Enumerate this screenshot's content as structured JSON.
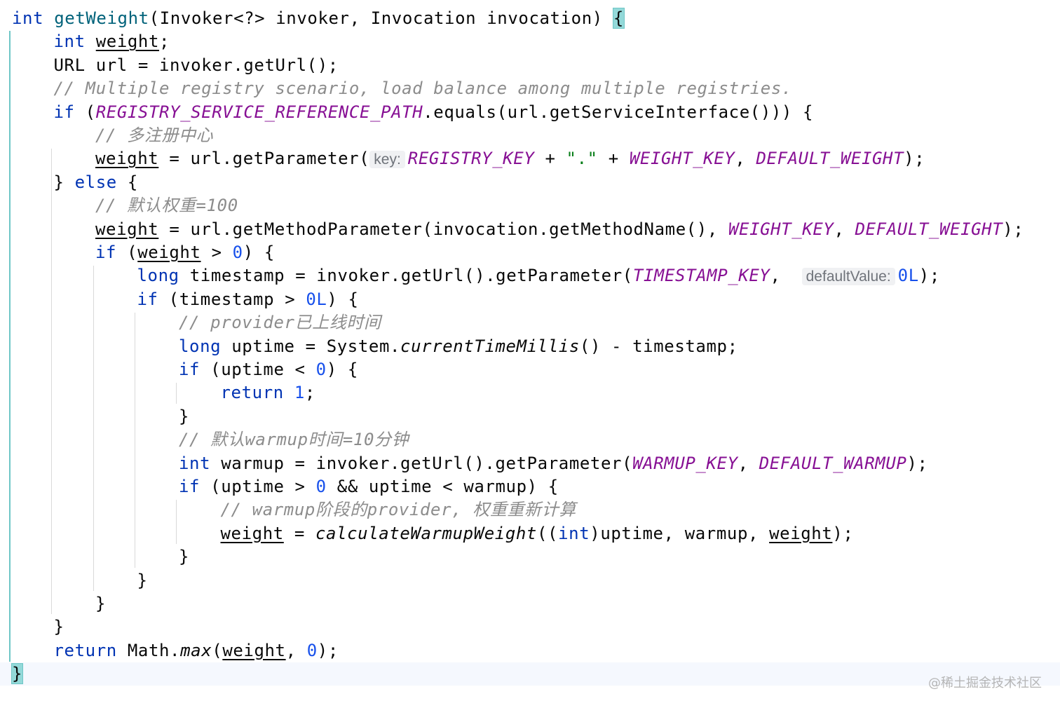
{
  "lines": [
    {
      "indent": 0,
      "tokens": [
        {
          "t": "int",
          "c": "kw"
        },
        {
          "t": " "
        },
        {
          "t": "getWeight",
          "c": "fn"
        },
        {
          "t": "(Invoker<?> invoker, Invocation invocation) "
        },
        {
          "t": "{",
          "c": "bracket-hl"
        }
      ]
    },
    {
      "indent": 1,
      "tokens": [
        {
          "t": "int",
          "c": "kw"
        },
        {
          "t": " "
        },
        {
          "t": "weight",
          "c": "uv"
        },
        {
          "t": ";"
        }
      ]
    },
    {
      "indent": 1,
      "tokens": [
        {
          "t": "URL url = invoker.getUrl();"
        }
      ]
    },
    {
      "indent": 1,
      "tokens": [
        {
          "t": "// Multiple registry scenario, load balance among multiple registries.",
          "c": "cmt"
        }
      ]
    },
    {
      "indent": 1,
      "tokens": [
        {
          "t": "if",
          "c": "kw"
        },
        {
          "t": " ("
        },
        {
          "t": "REGISTRY_SERVICE_REFERENCE_PATH",
          "c": "cst"
        },
        {
          "t": ".equals(url.getServiceInterface())) {"
        }
      ]
    },
    {
      "indent": 2,
      "tokens": [
        {
          "t": "// 多注册中心",
          "c": "cmt"
        }
      ]
    },
    {
      "indent": 2,
      "tokens": [
        {
          "t": "weight",
          "c": "uv"
        },
        {
          "t": " = url.getParameter("
        },
        {
          "t": "key:",
          "c": "hint"
        },
        {
          "t": "REGISTRY_KEY",
          "c": "cst"
        },
        {
          "t": " + "
        },
        {
          "t": "\".\"",
          "c": "str"
        },
        {
          "t": " + "
        },
        {
          "t": "WEIGHT_KEY",
          "c": "cst"
        },
        {
          "t": ", "
        },
        {
          "t": "DEFAULT_WEIGHT",
          "c": "cst"
        },
        {
          "t": ");"
        }
      ]
    },
    {
      "indent": 1,
      "tokens": [
        {
          "t": "} "
        },
        {
          "t": "else",
          "c": "kw"
        },
        {
          "t": " {"
        }
      ]
    },
    {
      "indent": 2,
      "tokens": [
        {
          "t": "// 默认权重=100",
          "c": "cmt"
        }
      ]
    },
    {
      "indent": 2,
      "tokens": [
        {
          "t": "weight",
          "c": "uv"
        },
        {
          "t": " = url.getMethodParameter(invocation.getMethodName(), "
        },
        {
          "t": "WEIGHT_KEY",
          "c": "cst"
        },
        {
          "t": ", "
        },
        {
          "t": "DEFAULT_WEIGHT",
          "c": "cst"
        },
        {
          "t": ");"
        }
      ]
    },
    {
      "indent": 2,
      "tokens": [
        {
          "t": "if",
          "c": "kw"
        },
        {
          "t": " ("
        },
        {
          "t": "weight",
          "c": "uv"
        },
        {
          "t": " > "
        },
        {
          "t": "0",
          "c": "num"
        },
        {
          "t": ") {"
        }
      ]
    },
    {
      "indent": 3,
      "tokens": [
        {
          "t": "long",
          "c": "kw"
        },
        {
          "t": " timestamp = invoker.getUrl().getParameter("
        },
        {
          "t": "TIMESTAMP_KEY",
          "c": "cst"
        },
        {
          "t": ",  "
        },
        {
          "t": "defaultValue:",
          "c": "hint"
        },
        {
          "t": "0L",
          "c": "num"
        },
        {
          "t": ");"
        }
      ]
    },
    {
      "indent": 3,
      "tokens": [
        {
          "t": "if",
          "c": "kw"
        },
        {
          "t": " (timestamp > "
        },
        {
          "t": "0L",
          "c": "num"
        },
        {
          "t": ") {"
        }
      ]
    },
    {
      "indent": 4,
      "tokens": [
        {
          "t": "// provider已上线时间",
          "c": "cmt"
        }
      ]
    },
    {
      "indent": 4,
      "tokens": [
        {
          "t": "long",
          "c": "kw"
        },
        {
          "t": " uptime = System."
        },
        {
          "t": "currentTimeMillis",
          "c": "ital"
        },
        {
          "t": "() - timestamp;"
        }
      ]
    },
    {
      "indent": 4,
      "tokens": [
        {
          "t": "if",
          "c": "kw"
        },
        {
          "t": " (uptime < "
        },
        {
          "t": "0",
          "c": "num"
        },
        {
          "t": ") {"
        }
      ]
    },
    {
      "indent": 5,
      "tokens": [
        {
          "t": "return",
          "c": "kw"
        },
        {
          "t": " "
        },
        {
          "t": "1",
          "c": "num"
        },
        {
          "t": ";"
        }
      ]
    },
    {
      "indent": 4,
      "tokens": [
        {
          "t": "}"
        }
      ]
    },
    {
      "indent": 4,
      "tokens": [
        {
          "t": "// 默认warmup时间=10分钟",
          "c": "cmt"
        }
      ]
    },
    {
      "indent": 4,
      "tokens": [
        {
          "t": "int",
          "c": "kw"
        },
        {
          "t": " warmup = invoker.getUrl().getParameter("
        },
        {
          "t": "WARMUP_KEY",
          "c": "cst"
        },
        {
          "t": ", "
        },
        {
          "t": "DEFAULT_WARMUP",
          "c": "cst"
        },
        {
          "t": ");"
        }
      ]
    },
    {
      "indent": 4,
      "tokens": [
        {
          "t": "if",
          "c": "kw"
        },
        {
          "t": " (uptime > "
        },
        {
          "t": "0",
          "c": "num"
        },
        {
          "t": " && uptime < warmup) {"
        }
      ]
    },
    {
      "indent": 5,
      "tokens": [
        {
          "t": "// warmup阶段的provider, 权重重新计算",
          "c": "cmt"
        }
      ]
    },
    {
      "indent": 5,
      "tokens": [
        {
          "t": "weight",
          "c": "uv"
        },
        {
          "t": " = "
        },
        {
          "t": "calculateWarmupWeight",
          "c": "ital"
        },
        {
          "t": "(("
        },
        {
          "t": "int",
          "c": "kw"
        },
        {
          "t": ")uptime, warmup, "
        },
        {
          "t": "weight",
          "c": "uv"
        },
        {
          "t": ");"
        }
      ]
    },
    {
      "indent": 4,
      "tokens": [
        {
          "t": "}"
        }
      ]
    },
    {
      "indent": 3,
      "tokens": [
        {
          "t": "}"
        }
      ]
    },
    {
      "indent": 2,
      "tokens": [
        {
          "t": "}"
        }
      ]
    },
    {
      "indent": 1,
      "tokens": [
        {
          "t": "}"
        }
      ]
    },
    {
      "indent": 1,
      "tokens": [
        {
          "t": "return",
          "c": "kw"
        },
        {
          "t": " Math."
        },
        {
          "t": "max",
          "c": "ital"
        },
        {
          "t": "("
        },
        {
          "t": "weight",
          "c": "uv"
        },
        {
          "t": ", "
        },
        {
          "t": "0",
          "c": "num"
        },
        {
          "t": ");"
        }
      ]
    },
    {
      "indent": 0,
      "tokens": [
        {
          "t": "}",
          "c": "bracket-hl"
        }
      ]
    }
  ],
  "watermark": "@稀土掘金技术社区",
  "colors": {
    "keyword": "#0033b3",
    "method": "#00627a",
    "number": "#1750eb",
    "string": "#067d17",
    "constant": "#871094",
    "comment": "#8c8c8c",
    "bracket_highlight": "#93d9d9"
  }
}
